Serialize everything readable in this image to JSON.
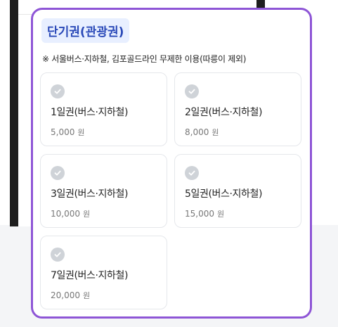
{
  "section": {
    "title": "단기권(관광권)",
    "note": "※ 서울버스·지하철, 김포골드라인 무제한 이용(따릉이 제외)"
  },
  "options": [
    {
      "title": "1일권(버스·지하철)",
      "price": "5,000",
      "unit": "원"
    },
    {
      "title": "2일권(버스·지하철)",
      "price": "8,000",
      "unit": "원"
    },
    {
      "title": "3일권(버스·지하철)",
      "price": "10,000",
      "unit": "원"
    },
    {
      "title": "5일권(버스·지하철)",
      "price": "15,000",
      "unit": "원"
    },
    {
      "title": "7일권(버스·지하철)",
      "price": "20,000",
      "unit": "원"
    }
  ],
  "icons": {
    "option_check": "check-circle-icon"
  },
  "colors": {
    "accent_border": "#8e55d6",
    "tag_bg": "#e8efff",
    "tag_text": "#2a49b8",
    "check_bg": "#cfd3d8"
  }
}
